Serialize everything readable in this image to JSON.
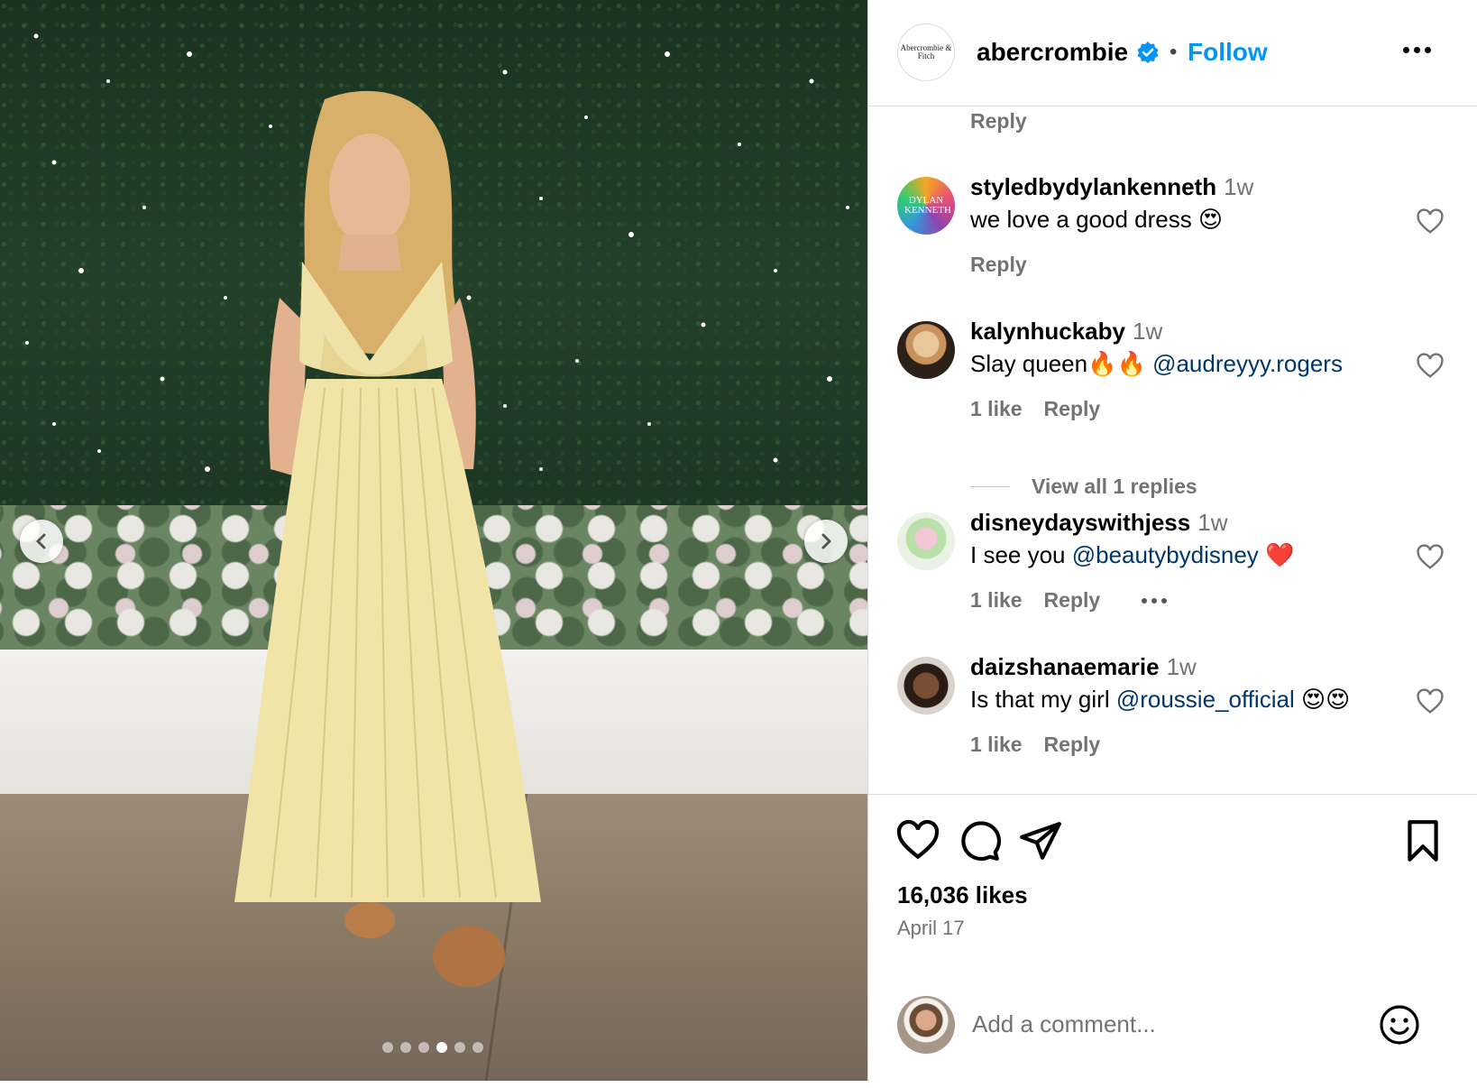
{
  "post": {
    "carousel": {
      "total": 6,
      "active_index": 3
    }
  },
  "header": {
    "brand_logo_text": "Abercrombie & Fitch",
    "username": "abercrombie",
    "separator": "•",
    "follow_label": "Follow"
  },
  "comments": {
    "reply_label": "Reply",
    "items": [
      {
        "username": "styledbydylankenneth",
        "time": "1w",
        "text": "we love a good dress 😍",
        "likes": "",
        "avatar_text": "DYLAN KENNETH"
      },
      {
        "username": "kalynhuckaby",
        "time": "1w",
        "text_before": "Slay queen🔥🔥 ",
        "mention": "@audreyyy.rogers",
        "text_after": "",
        "likes": "1 like"
      },
      {
        "username": "disneydayswithjess",
        "time": "1w",
        "text_before": "I see you ",
        "mention": "@beautybydisney",
        "text_after": " ❤️",
        "likes": "1 like"
      },
      {
        "username": "daizshanaemarie",
        "time": "1w",
        "text_before": "Is that my girl ",
        "mention": "@roussie_official",
        "text_after": " 😍😍",
        "likes": "1 like"
      }
    ],
    "view_replies": "View all 1 replies"
  },
  "actions": {
    "icons": [
      "heart-icon",
      "comment-icon",
      "share-icon",
      "bookmark-icon"
    ],
    "likes": "16,036 likes",
    "date": "April 17"
  },
  "add_comment": {
    "placeholder": "Add a comment..."
  },
  "colors": {
    "accent": "#0095f6",
    "mention": "#00376b",
    "muted": "#737373",
    "divider": "#dbdbdb"
  }
}
